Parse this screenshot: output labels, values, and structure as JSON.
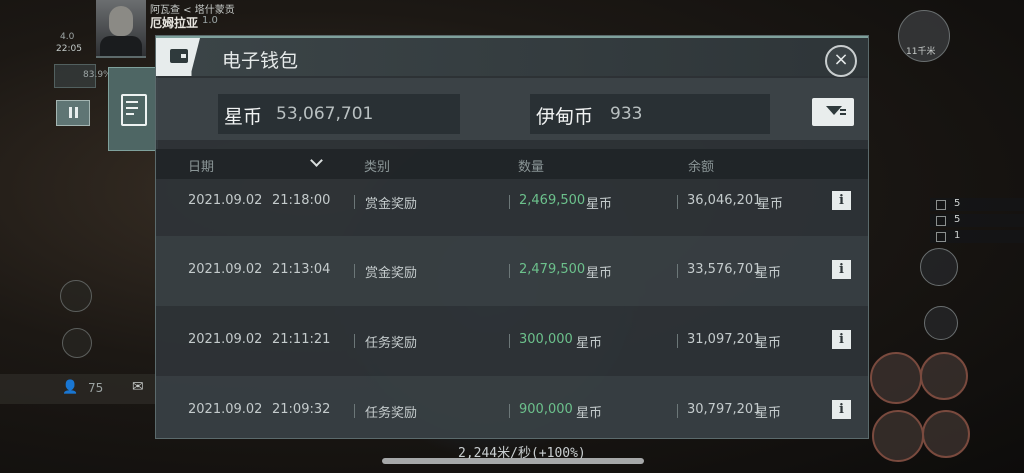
{
  "hud": {
    "player_sub": "阿瓦查 < 塔什蒙贡",
    "player_name": "厄姆拉亚",
    "security": "1.0",
    "left_small_top": "4.0",
    "time": "22:05",
    "cargo": "83.9%",
    "local_count": "75",
    "right_stats": [
      "5",
      "5",
      "1"
    ],
    "right_top_label": "11千米",
    "speed": "2,244米/秒(+100%)"
  },
  "wallet": {
    "title": "电子钱包",
    "isk_label": "星币",
    "isk_value": "53,067,701",
    "plex_label": "伊甸币",
    "plex_value": "933",
    "columns": {
      "date": "日期",
      "type": "类别",
      "amount": "数量",
      "balance": "余额"
    },
    "rows": [
      {
        "date": "2021.09.02",
        "time": "21:18:00",
        "type": "赏金奖励",
        "amount": "2,469,500",
        "amount_unit": "星币",
        "balance": "36,046,201",
        "balance_unit": "星币"
      },
      {
        "date": "2021.09.02",
        "time": "21:13:04",
        "type": "赏金奖励",
        "amount": "2,479,500",
        "amount_unit": "星币",
        "balance": "33,576,701",
        "balance_unit": "星币"
      },
      {
        "date": "2021.09.02",
        "time": "21:11:21",
        "type": "任务奖励",
        "amount": "300,000",
        "amount_unit": "星币",
        "balance": "31,097,201",
        "balance_unit": "星币"
      },
      {
        "date": "2021.09.02",
        "time": "21:09:32",
        "type": "任务奖励",
        "amount": "900,000",
        "amount_unit": "星币",
        "balance": "30,797,201",
        "balance_unit": "星币"
      }
    ],
    "info_glyph": "i",
    "close_glyph": "×"
  },
  "colors": {
    "accent": "#7fa19c",
    "positive": "#6cc18c",
    "panel_bg": "#2e3538"
  }
}
